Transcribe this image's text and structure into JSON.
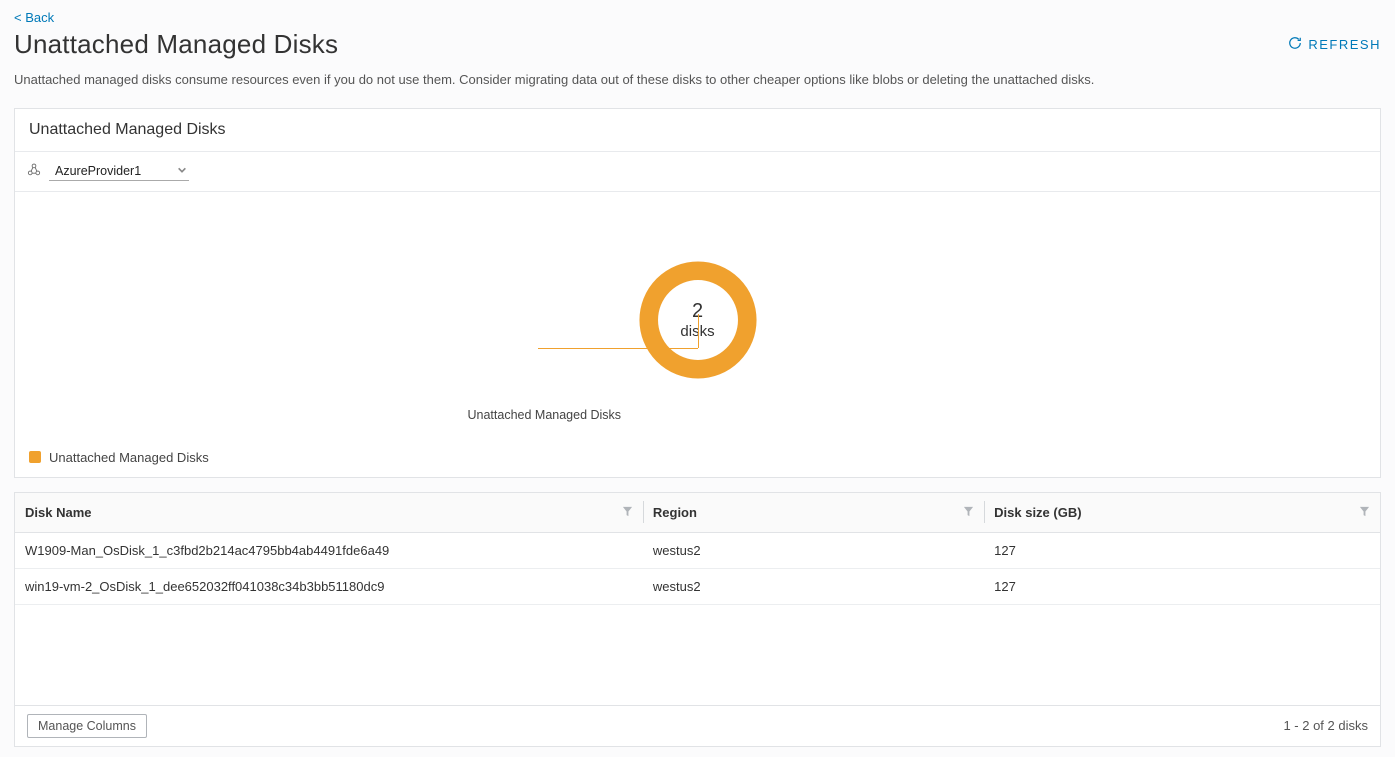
{
  "nav": {
    "back_label": "< Back"
  },
  "header": {
    "title": "Unattached Managed Disks",
    "refresh_label": "REFRESH"
  },
  "description": "Unattached managed disks consume resources even if you do not use them. Consider migrating data out of these disks to other cheaper options like blobs or deleting the unattached disks.",
  "panel": {
    "title": "Unattached Managed Disks",
    "provider_selected": "AzureProvider1"
  },
  "chart_data": {
    "type": "pie",
    "title": "",
    "categories": [
      "Unattached Managed Disks"
    ],
    "values": [
      2
    ],
    "unit": "disks",
    "colors": [
      "#f0a12e"
    ],
    "center_label": {
      "count": "2",
      "unit": "disks"
    },
    "callout_label": "Unattached Managed Disks",
    "legend": [
      {
        "label": "Unattached Managed Disks",
        "color": "#f0a12e"
      }
    ]
  },
  "grid": {
    "columns": [
      {
        "key": "name",
        "label": "Disk Name"
      },
      {
        "key": "region",
        "label": "Region"
      },
      {
        "key": "size",
        "label": "Disk size (GB)"
      }
    ],
    "rows": [
      {
        "name": "W1909-Man_OsDisk_1_c3fbd2b214ac4795bb4ab4491fde6a49",
        "region": "westus2",
        "size": "127"
      },
      {
        "name": "win19-vm-2_OsDisk_1_dee652032ff041038c34b3bb51180dc9",
        "region": "westus2",
        "size": "127"
      }
    ],
    "manage_columns_label": "Manage Columns",
    "summary": "1 - 2 of 2 disks"
  }
}
